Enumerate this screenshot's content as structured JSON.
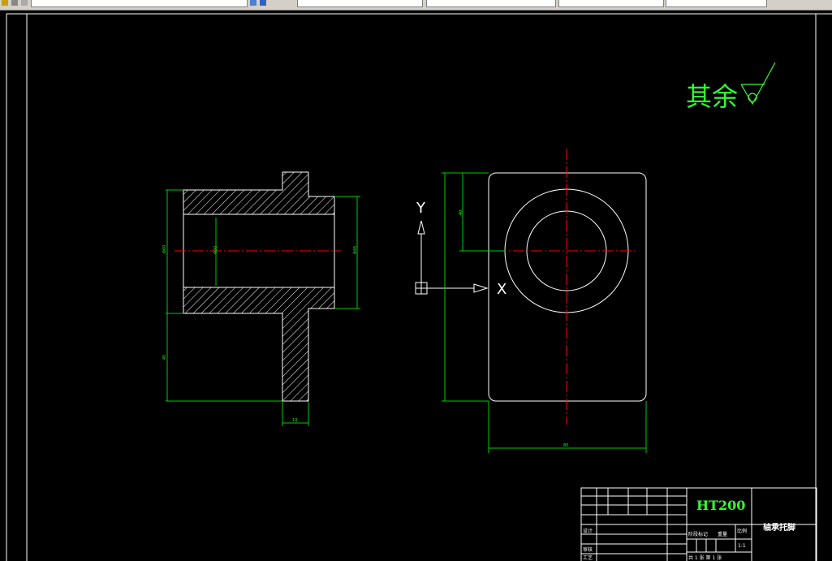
{
  "window": {
    "toolbar_fields": [
      "",
      "",
      "",
      "",
      "",
      ""
    ]
  },
  "drawing": {
    "roughness_note": "其余",
    "ucs": {
      "x_label": "X",
      "y_label": "Y"
    },
    "dimension_labels": {
      "front_outer_height": "Φ60",
      "front_bore": "Φ30",
      "front_flange": "Φ45",
      "front_base_height": "45",
      "front_web_width": "10",
      "side_top_offset": "40",
      "side_width": "80"
    }
  },
  "title_block": {
    "material": "HT200",
    "part_name": "轴承托脚",
    "row_label_1": "设计",
    "row_label_2": "审核",
    "row_label_3": "工艺",
    "batch_marks": "阶段标记",
    "weight": "重量",
    "scale": "比例",
    "scale_value": "1:1",
    "sheet_info": "共 1 张  第 1 张"
  },
  "colors": {
    "background": "#000000",
    "line_white": "#ffffff",
    "dimension_green": "#00ff00",
    "centerline_red": "#ff0000",
    "text_green": "#33ff33"
  }
}
